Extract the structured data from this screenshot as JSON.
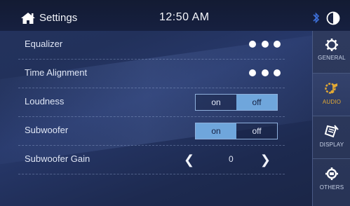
{
  "header": {
    "title": "Settings",
    "time": "12:50 AM"
  },
  "rows": [
    {
      "label": "Equalizer",
      "control": "more"
    },
    {
      "label": "Time Alignment",
      "control": "more"
    },
    {
      "label": "Loudness",
      "control": "toggle",
      "on_label": "on",
      "off_label": "off",
      "selected": "off"
    },
    {
      "label": "Subwoofer",
      "control": "toggle",
      "on_label": "on",
      "off_label": "off",
      "selected": "on"
    },
    {
      "label": "Subwoofer Gain",
      "control": "stepper",
      "value": "0"
    }
  ],
  "sidebar": {
    "tabs": [
      {
        "label": "GENERAL",
        "icon": "gear-icon",
        "active": false
      },
      {
        "label": "AUDIO",
        "icon": "audio-settings-icon",
        "active": true
      },
      {
        "label": "DISPLAY",
        "icon": "display-icon",
        "active": false
      },
      {
        "label": "OTHERS",
        "icon": "others-icon",
        "active": false
      }
    ]
  },
  "colors": {
    "accent_active_toggle": "#6fa6dc",
    "active_tab_label": "#e3a934",
    "bluetooth": "#3d6fd8"
  }
}
